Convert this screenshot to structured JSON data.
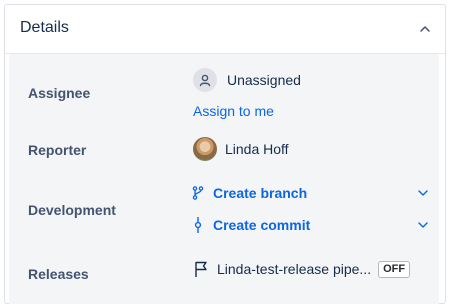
{
  "panel": {
    "title": "Details",
    "collapse_icon": "chevron-up-icon"
  },
  "assignee": {
    "label": "Assignee",
    "value": "Unassigned",
    "action": "Assign to me",
    "icon": "person-icon"
  },
  "reporter": {
    "label": "Reporter",
    "name": "Linda Hoff"
  },
  "development": {
    "label": "Development",
    "create_branch": "Create branch",
    "create_commit": "Create commit",
    "branch_icon": "branch-icon",
    "commit_icon": "commit-icon"
  },
  "releases": {
    "label": "Releases",
    "value": "Linda-test-release pipe...",
    "badge": "OFF",
    "icon": "flag-icon"
  },
  "colors": {
    "link": "#0c66e4",
    "label": "#44546f",
    "text": "#172b4d",
    "background": "#f4f5f7"
  }
}
